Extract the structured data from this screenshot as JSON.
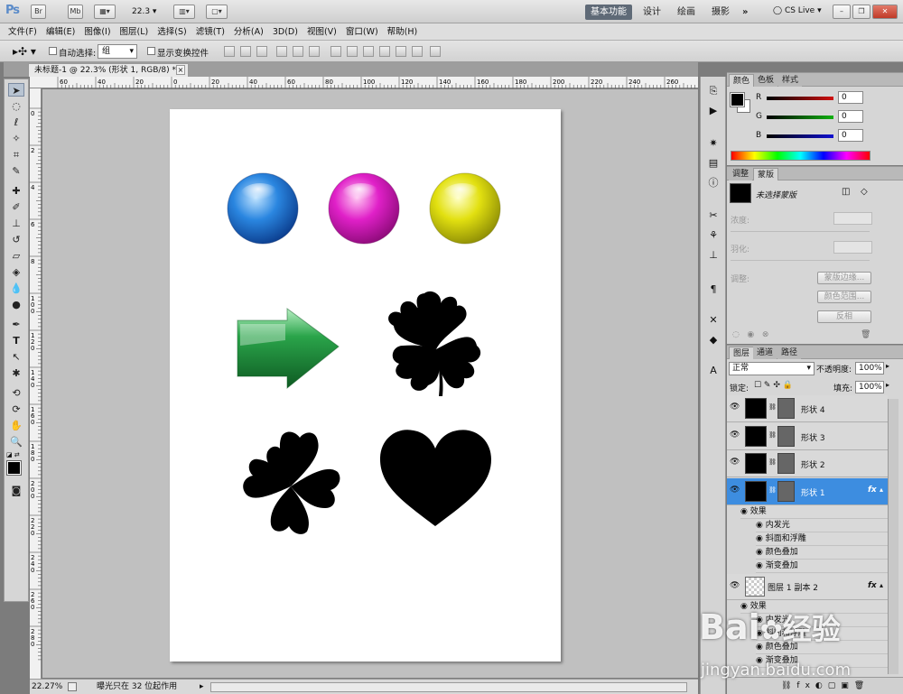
{
  "app": {
    "logo": "Ps",
    "zoom_value": "22.3",
    "workspaces": [
      "基本功能",
      "设计",
      "绘画",
      "摄影"
    ],
    "more": "»",
    "cslive": "CS Live"
  },
  "menu": [
    "文件(F)",
    "编辑(E)",
    "图像(I)",
    "图层(L)",
    "选择(S)",
    "滤镜(T)",
    "分析(A)",
    "3D(D)",
    "视图(V)",
    "窗口(W)",
    "帮助(H)"
  ],
  "options": {
    "auto_select_label": "自动选择:",
    "auto_select_value": "组",
    "show_transform_label": "显示变换控件"
  },
  "document": {
    "tab_title": "未标题-1 @ 22.3% (形状 1, RGB/8) *",
    "close": "×",
    "ruler_h": [
      "60",
      "40",
      "20",
      "0",
      "20",
      "40",
      "60",
      "80",
      "100",
      "120",
      "140",
      "160",
      "180",
      "200",
      "220",
      "240",
      "260"
    ],
    "ruler_v": [
      "0",
      "2",
      "4",
      "6",
      "8",
      "1 0 0",
      "1 2 0",
      "1 4 0",
      "1 6 0",
      "1 8 0",
      "2 0 0",
      "2 2 0",
      "2 4 0",
      "2 6 0",
      "2 8 0"
    ],
    "sphere_colors": [
      "#2a86e0",
      "#e020c8",
      "#e2e010"
    ],
    "arrow_color": "#2aa44a",
    "shape_color": "#000000"
  },
  "status": {
    "zoom": "22.27%",
    "info": "曝光只在 32 位起作用"
  },
  "color_panel": {
    "tabs": [
      "颜色",
      "色板",
      "样式"
    ],
    "channels": [
      {
        "label": "R",
        "value": "0",
        "color": "#d01010"
      },
      {
        "label": "G",
        "value": "0",
        "color": "#10b010"
      },
      {
        "label": "B",
        "value": "0",
        "color": "#1010d0"
      }
    ]
  },
  "masks_panel": {
    "tabs": [
      "调整",
      "蒙版"
    ],
    "no_mask": "未选择蒙版",
    "density": "浓度:",
    "feather": "羽化:",
    "refine": "调整:",
    "btn_edge": "蒙版边缘...",
    "btn_range": "颜色范围...",
    "btn_invert": "反相"
  },
  "layers_panel": {
    "tabs": [
      "图层",
      "通道",
      "路径"
    ],
    "blend_mode": "正常",
    "opacity_label": "不透明度:",
    "opacity_value": "100%",
    "lock_label": "锁定:",
    "fill_label": "填充:",
    "fill_value": "100%",
    "layers": [
      "形状 4",
      "形状 3",
      "形状 2",
      "形状 1"
    ],
    "fx": "fx",
    "effects_label": "效果",
    "effects": [
      "内发光",
      "斜面和浮雕",
      "颜色叠加",
      "渐变叠加"
    ],
    "layer_copy": "图层 1 副本 2",
    "effects_label_2": "效果",
    "effects_2": [
      "内发光",
      "斜面和浮雕",
      "颜色叠加",
      "渐变叠加"
    ]
  },
  "watermark": {
    "brand": "Bai",
    "brand2": "经验",
    "url": "jingyan.baidu.com"
  }
}
